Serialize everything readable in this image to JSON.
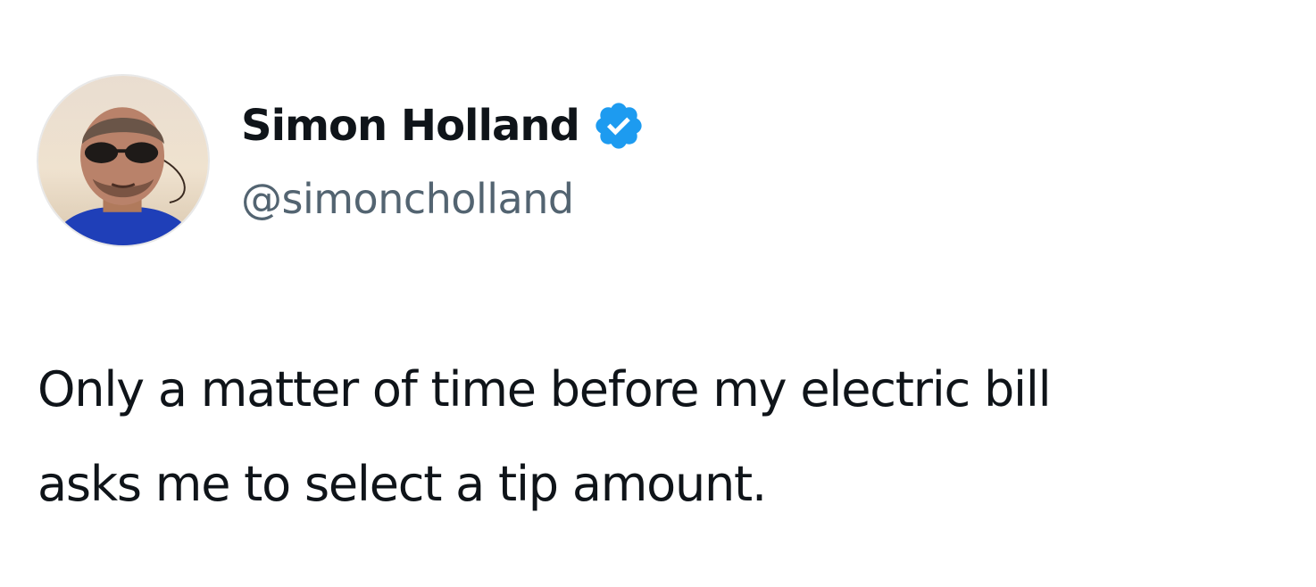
{
  "author": {
    "display_name": "Simon Holland",
    "handle": "@simoncholland",
    "verified": true,
    "verified_badge_color": "#1d9bf0",
    "avatar_icon": "profile-photo"
  },
  "tweet": {
    "lines": [
      "Only a matter of time before my electric bill",
      "asks me to select a tip amount."
    ]
  },
  "colors": {
    "text_primary": "#0f1419",
    "text_secondary": "#536471",
    "background": "#ffffff"
  }
}
